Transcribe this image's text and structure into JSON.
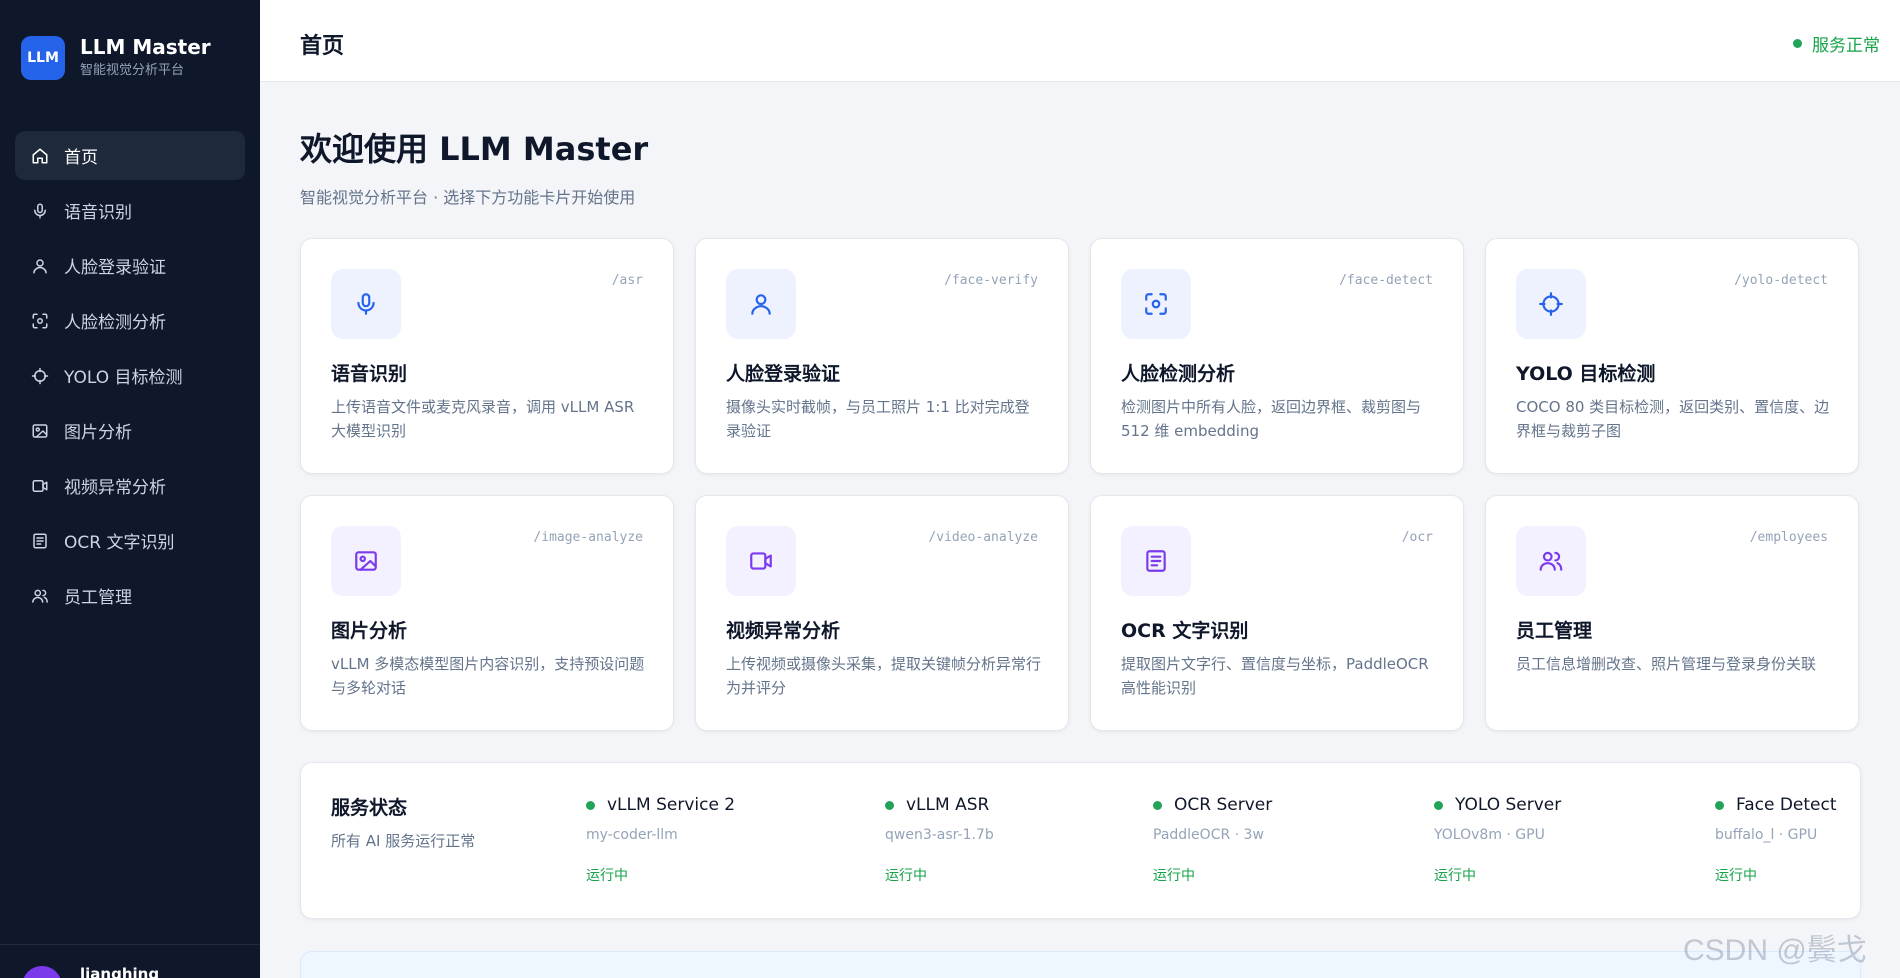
{
  "brand": {
    "logo": "LLM",
    "title": "LLM Master",
    "subtitle": "智能视觉分析平台"
  },
  "sidebar": {
    "items": [
      {
        "label": "首页",
        "icon": "home-icon",
        "active": true
      },
      {
        "label": "语音识别",
        "icon": "microphone-icon"
      },
      {
        "label": "人脸登录验证",
        "icon": "user-icon"
      },
      {
        "label": "人脸检测分析",
        "icon": "face-scan-icon"
      },
      {
        "label": "YOLO 目标检测",
        "icon": "crosshair-icon"
      },
      {
        "label": "图片分析",
        "icon": "image-icon"
      },
      {
        "label": "视频异常分析",
        "icon": "video-icon"
      },
      {
        "label": "OCR 文字识别",
        "icon": "document-icon"
      },
      {
        "label": "员工管理",
        "icon": "users-icon"
      }
    ],
    "user": {
      "name": "lianghing"
    }
  },
  "header": {
    "title": "首页",
    "status": "服务正常"
  },
  "welcome": {
    "title": "欢迎使用 LLM Master",
    "subtitle": "智能视觉分析平台 · 选择下方功能卡片开始使用"
  },
  "cards": [
    {
      "route": "/asr",
      "title": "语音识别",
      "desc": "上传语音文件或麦克风录音，调用 vLLM ASR 大模型识别",
      "icon": "microphone-icon",
      "tone": "blue"
    },
    {
      "route": "/face-verify",
      "title": "人脸登录验证",
      "desc": "摄像头实时截帧，与员工照片 1:1 比对完成登录验证",
      "icon": "user-icon",
      "tone": "blue"
    },
    {
      "route": "/face-detect",
      "title": "人脸检测分析",
      "desc": "检测图片中所有人脸，返回边界框、裁剪图与 512 维 embedding",
      "icon": "face-scan-icon",
      "tone": "blue"
    },
    {
      "route": "/yolo-detect",
      "title": "YOLO 目标检测",
      "desc": "COCO 80 类目标检测，返回类别、置信度、边界框与裁剪子图",
      "icon": "crosshair-icon",
      "tone": "blue"
    },
    {
      "route": "/image-analyze",
      "title": "图片分析",
      "desc": "vLLM 多模态模型图片内容识别，支持预设问题与多轮对话",
      "icon": "image-icon",
      "tone": "purple"
    },
    {
      "route": "/video-analyze",
      "title": "视频异常分析",
      "desc": "上传视频或摄像头采集，提取关键帧分析异常行为并评分",
      "icon": "video-icon",
      "tone": "purple"
    },
    {
      "route": "/ocr",
      "title": "OCR 文字识别",
      "desc": "提取图片文字行、置信度与坐标，PaddleOCR 高性能识别",
      "icon": "document-icon",
      "tone": "purple"
    },
    {
      "route": "/employees",
      "title": "员工管理",
      "desc": "员工信息增删改查、照片管理与登录身份关联",
      "icon": "users-icon",
      "tone": "purple"
    }
  ],
  "services": {
    "title": "服务状态",
    "subtitle": "所有 AI 服务运行正常",
    "items": [
      {
        "name": "vLLM Service 2",
        "meta": "my-coder-llm",
        "state": "运行中"
      },
      {
        "name": "vLLM ASR",
        "meta": "qwen3-asr-1.7b",
        "state": "运行中"
      },
      {
        "name": "OCR Server",
        "meta": "PaddleOCR · 3w",
        "state": "运行中"
      },
      {
        "name": "YOLO Server",
        "meta": "YOLOv8m · GPU",
        "state": "运行中"
      },
      {
        "name": "Face Detect",
        "meta": "buffalo_l · GPU",
        "state": "运行中"
      }
    ]
  },
  "watermark": "CSDN @鬓戈",
  "colors": {
    "sidebar_bg": "#0f172a",
    "accent_blue": "#2563eb",
    "accent_purple": "#7c3aed",
    "status_green": "#16a34a"
  }
}
